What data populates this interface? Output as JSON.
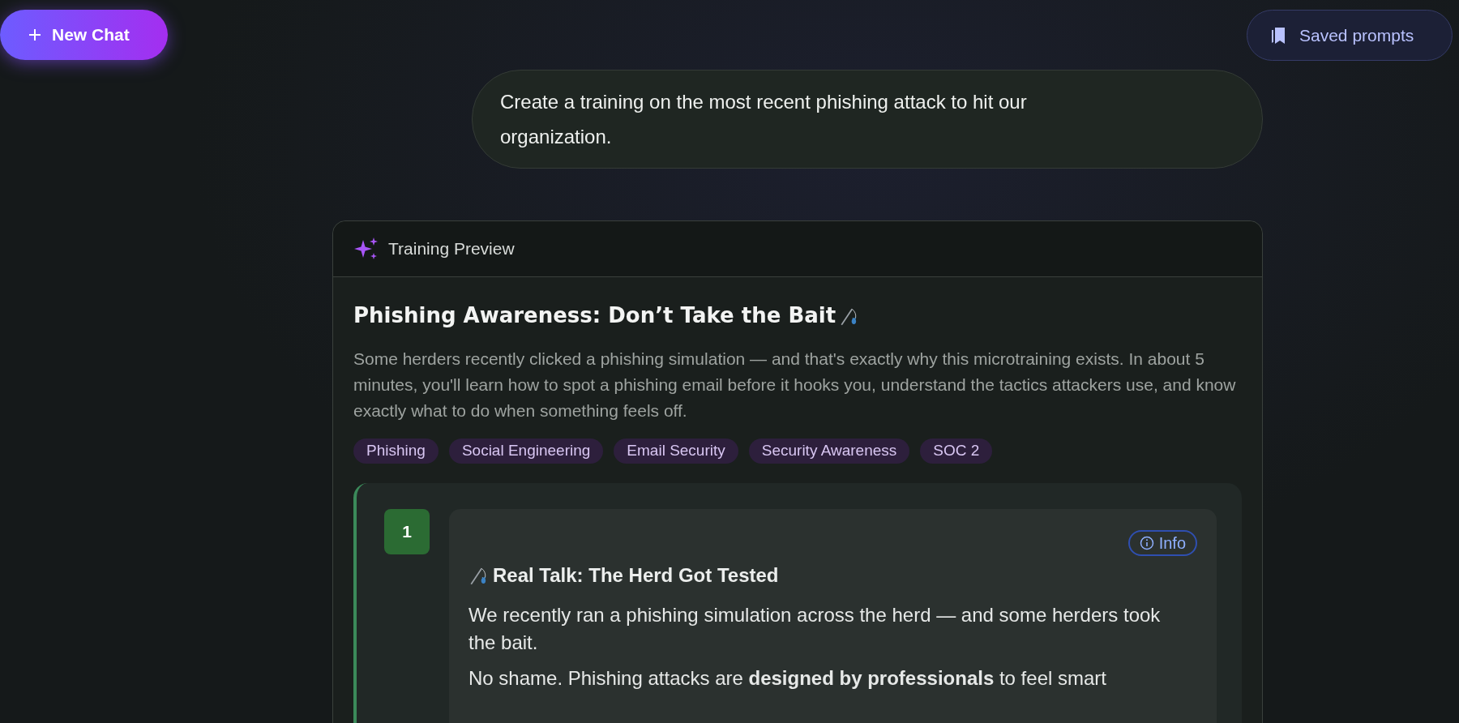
{
  "header": {
    "new_chat": "New Chat",
    "saved_prompts": "Saved prompts"
  },
  "user_message": "Create a training on the most recent phishing attack to hit our organization.",
  "preview": {
    "label": "Training Preview",
    "title": "Phishing Awareness: Don’t Take the Bait",
    "description": "Some herders recently clicked a phishing simulation — and that's exactly why this microtraining exists. In about 5 minutes, you'll learn how to spot a phishing email before it hooks you, understand the tactics attackers use, and know exactly what to do when something feels off.",
    "tags": [
      "Phishing",
      "Social Engineering",
      "Email Security",
      "Security Awareness",
      "SOC 2"
    ],
    "steps": [
      {
        "number": "1",
        "badge": "Info",
        "heading": "Real Talk: The Herd Got Tested",
        "paragraphs": [
          "We recently ran a phishing simulation across the herd — and some herders took the bait.",
          "No shame. Phishing attacks are **designed by professionals** to feel smart"
        ]
      }
    ]
  }
}
